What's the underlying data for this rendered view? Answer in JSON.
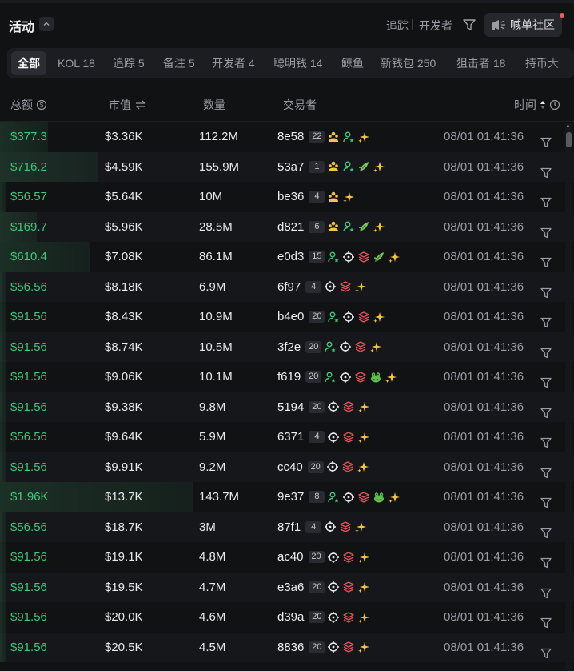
{
  "header": {
    "title": "活动",
    "follow_label": "追踪",
    "dev_label": "开发者",
    "community_label": "喊单社区"
  },
  "tabs": [
    {
      "label": "全部",
      "active": true
    },
    {
      "label": "KOL 18"
    },
    {
      "label": "追踪 5"
    },
    {
      "label": "备注 5"
    },
    {
      "label": "开发者 4"
    },
    {
      "label": "聪明钱 14"
    },
    {
      "label": "鲸鱼"
    },
    {
      "label": "新钱包 250"
    },
    {
      "label": "狙击者 18"
    },
    {
      "label": "持币大"
    }
  ],
  "columns": {
    "total": "总额",
    "mcap": "市值",
    "qty": "数量",
    "trader": "交易者",
    "time": "时间"
  },
  "colors": {
    "green": "#3fc77a",
    "bg": "#111214"
  },
  "rows": [
    {
      "total": "$377.3",
      "mcap": "$3.36K",
      "qty": "112.2M",
      "addr": "8e58",
      "count": "22",
      "icons": [
        "whale-icon",
        "user-star-icon",
        "sparkle-icon"
      ],
      "time": "08/01 01:41:36",
      "bar_fraction": 0.17
    },
    {
      "total": "$716.2",
      "mcap": "$4.59K",
      "qty": "155.9M",
      "addr": "53a7",
      "count": "1",
      "icons": [
        "whale-icon",
        "user-star-icon",
        "leaf-icon",
        "sparkle-icon"
      ],
      "time": "08/01 01:41:36",
      "bar_fraction": 0.35
    },
    {
      "total": "$56.57",
      "mcap": "$5.64K",
      "qty": "10M",
      "addr": "be36",
      "count": "4",
      "icons": [
        "whale-icon",
        "sparkle-icon"
      ],
      "time": "08/01 01:41:36",
      "bar_fraction": 0.02
    },
    {
      "total": "$169.7",
      "mcap": "$5.96K",
      "qty": "28.5M",
      "addr": "d821",
      "count": "6",
      "icons": [
        "whale-icon",
        "user-star-icon",
        "leaf-icon",
        "sparkle-icon"
      ],
      "time": "08/01 01:41:36",
      "bar_fraction": 0.13
    },
    {
      "total": "$610.4",
      "mcap": "$7.08K",
      "qty": "86.1M",
      "addr": "e0d3",
      "count": "15",
      "icons": [
        "user-star-icon",
        "crosshair-icon",
        "layers-icon",
        "leaf-icon",
        "sparkle-icon"
      ],
      "time": "08/01 01:41:36",
      "bar_fraction": 0.32
    },
    {
      "total": "$56.56",
      "mcap": "$8.18K",
      "qty": "6.9M",
      "addr": "6f97",
      "count": "4",
      "icons": [
        "crosshair-icon",
        "layers-icon",
        "sparkle-icon"
      ],
      "time": "08/01 01:41:36",
      "bar_fraction": 0.02
    },
    {
      "total": "$91.56",
      "mcap": "$8.43K",
      "qty": "10.9M",
      "addr": "b4e0",
      "count": "20",
      "icons": [
        "user-star-icon",
        "crosshair-icon",
        "layers-icon",
        "sparkle-icon"
      ],
      "time": "08/01 01:41:36",
      "bar_fraction": 0.02
    },
    {
      "total": "$91.56",
      "mcap": "$8.74K",
      "qty": "10.5M",
      "addr": "3f2e",
      "count": "20",
      "icons": [
        "user-star-icon",
        "crosshair-icon",
        "layers-icon",
        "sparkle-icon"
      ],
      "time": "08/01 01:41:36",
      "bar_fraction": 0.02
    },
    {
      "total": "$91.56",
      "mcap": "$9.06K",
      "qty": "10.1M",
      "addr": "f619",
      "count": "20",
      "icons": [
        "user-star-icon",
        "crosshair-icon",
        "layers-icon",
        "frog-icon",
        "sparkle-icon"
      ],
      "time": "08/01 01:41:36",
      "bar_fraction": 0.02
    },
    {
      "total": "$91.56",
      "mcap": "$9.38K",
      "qty": "9.8M",
      "addr": "5194",
      "count": "20",
      "icons": [
        "crosshair-icon",
        "layers-icon",
        "sparkle-icon"
      ],
      "time": "08/01 01:41:36",
      "bar_fraction": 0.02
    },
    {
      "total": "$56.56",
      "mcap": "$9.64K",
      "qty": "5.9M",
      "addr": "6371",
      "count": "4",
      "icons": [
        "crosshair-icon",
        "layers-icon",
        "sparkle-icon"
      ],
      "time": "08/01 01:41:36",
      "bar_fraction": 0.02
    },
    {
      "total": "$91.56",
      "mcap": "$9.91K",
      "qty": "9.2M",
      "addr": "cc40",
      "count": "20",
      "icons": [
        "crosshair-icon",
        "layers-icon",
        "sparkle-icon"
      ],
      "time": "08/01 01:41:36",
      "bar_fraction": 0.02
    },
    {
      "total": "$1.96K",
      "mcap": "$13.7K",
      "qty": "143.7M",
      "addr": "9e37",
      "count": "8",
      "icons": [
        "user-star-icon",
        "crosshair-icon",
        "layers-icon",
        "frog-icon",
        "sparkle-icon"
      ],
      "time": "08/01 01:41:36",
      "bar_fraction": 0.69
    },
    {
      "total": "$56.56",
      "mcap": "$18.7K",
      "qty": "3M",
      "addr": "87f1",
      "count": "4",
      "icons": [
        "crosshair-icon",
        "layers-icon",
        "sparkle-icon"
      ],
      "time": "08/01 01:41:36",
      "bar_fraction": 0.02
    },
    {
      "total": "$91.56",
      "mcap": "$19.1K",
      "qty": "4.8M",
      "addr": "ac40",
      "count": "20",
      "icons": [
        "crosshair-icon",
        "layers-icon",
        "sparkle-icon"
      ],
      "time": "08/01 01:41:36",
      "bar_fraction": 0.02
    },
    {
      "total": "$91.56",
      "mcap": "$19.5K",
      "qty": "4.7M",
      "addr": "e3a6",
      "count": "20",
      "icons": [
        "crosshair-icon",
        "layers-icon",
        "sparkle-icon"
      ],
      "time": "08/01 01:41:36",
      "bar_fraction": 0.02
    },
    {
      "total": "$91.56",
      "mcap": "$20.0K",
      "qty": "4.6M",
      "addr": "d39a",
      "count": "20",
      "icons": [
        "crosshair-icon",
        "layers-icon",
        "sparkle-icon"
      ],
      "time": "08/01 01:41:36",
      "bar_fraction": 0.02
    },
    {
      "total": "$91.56",
      "mcap": "$20.5K",
      "qty": "4.5M",
      "addr": "8836",
      "count": "20",
      "icons": [
        "crosshair-icon",
        "layers-icon",
        "sparkle-icon"
      ],
      "time": "08/01 01:41:36",
      "bar_fraction": 0.02
    }
  ]
}
